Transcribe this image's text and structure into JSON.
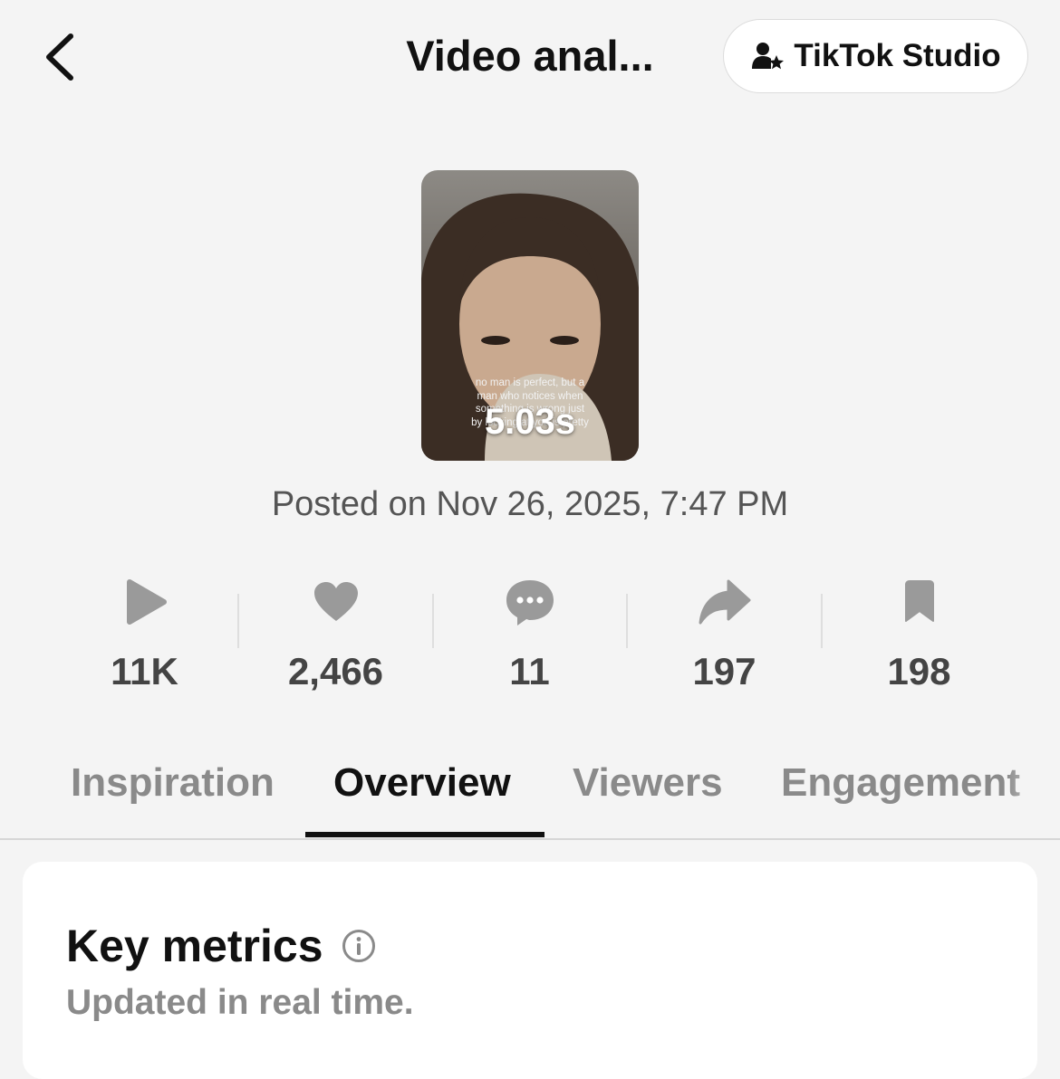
{
  "header": {
    "back_icon": "chevron-left-icon",
    "title": "Video anal...",
    "studio_button": {
      "icon": "person-star-icon",
      "label": "TikTok Studio"
    }
  },
  "video": {
    "caption_lines": [
      "no man is perfect, but a",
      "man who notices when",
      "something is wrong just",
      "by looking at you is pretty"
    ],
    "duration": "5.03s",
    "posted": "Posted on Nov 26, 2025, 7:47 PM"
  },
  "stats": [
    {
      "icon": "play-icon",
      "value": "11K"
    },
    {
      "icon": "heart-icon",
      "value": "2,466"
    },
    {
      "icon": "comment-icon",
      "value": "11"
    },
    {
      "icon": "share-icon",
      "value": "197"
    },
    {
      "icon": "bookmark-icon",
      "value": "198"
    }
  ],
  "tabs": [
    {
      "label": "Inspiration",
      "active": false
    },
    {
      "label": "Overview",
      "active": true
    },
    {
      "label": "Viewers",
      "active": false
    },
    {
      "label": "Engagement",
      "active": false
    }
  ],
  "key_metrics": {
    "title": "Key metrics",
    "info_icon": "info-icon",
    "subtitle": "Updated in real time."
  },
  "colors": {
    "background": "#f4f4f4",
    "icon_gray": "#9a9a9a",
    "text_dark": "#111111",
    "text_muted": "#8a8a8a"
  }
}
